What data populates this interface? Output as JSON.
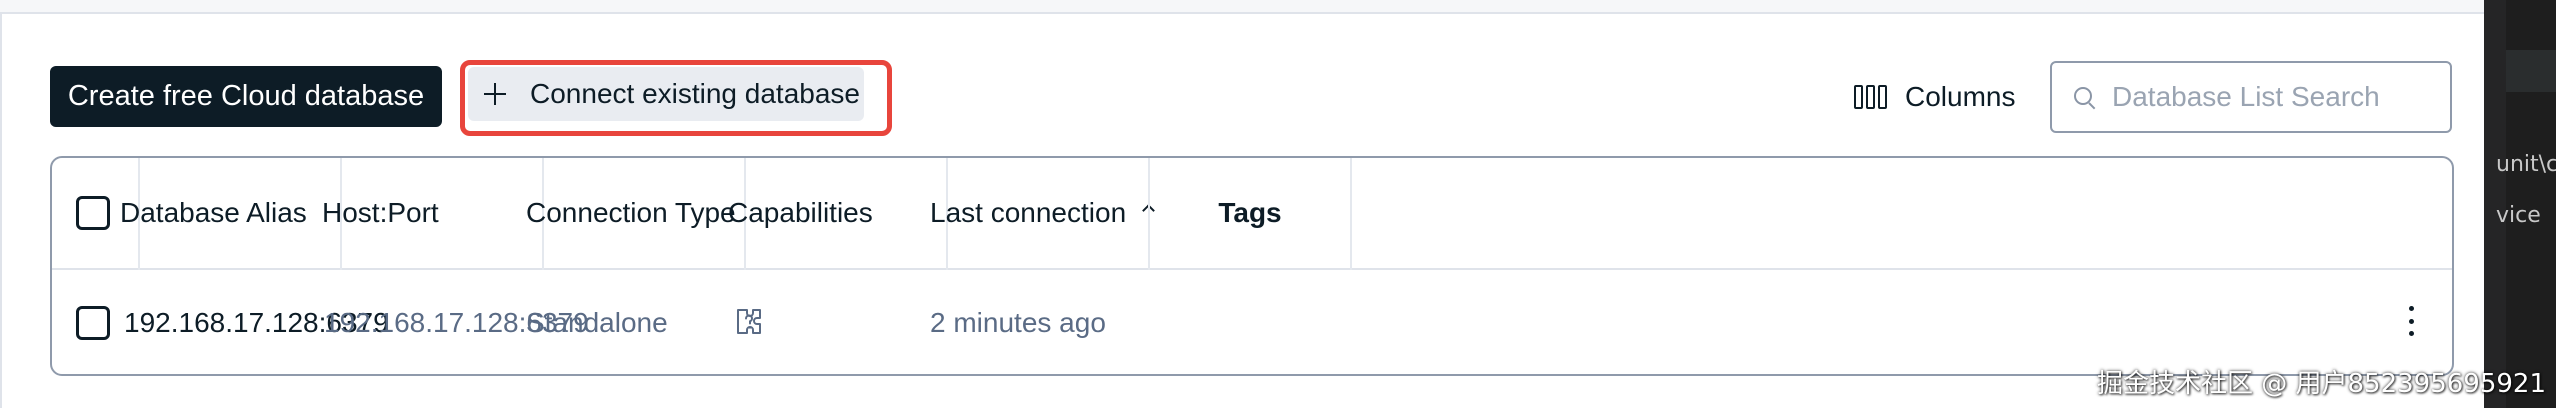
{
  "toolbar": {
    "create_label": "Create free Cloud database",
    "connect_label": "Connect existing database",
    "columns_label": "Columns",
    "search_placeholder": "Database List Search"
  },
  "table": {
    "headers": [
      "Database Alias",
      "Host:Port",
      "Connection Type",
      "Capabilities",
      "Last connection",
      "Tags"
    ],
    "sorted_column": "Last connection",
    "sort_direction": "ascending",
    "rows": [
      {
        "alias": "192.168.17.128:6379",
        "host_port": "192.168.17.128:6379",
        "connection_type": "Standalone",
        "capabilities_icon": "puzzle-question-icon",
        "last_connection": "2 minutes ago",
        "tags": ""
      }
    ]
  },
  "editor_strip": {
    "line1": "unit\\co",
    "line2": "vice"
  },
  "watermark": "掘金技术社区 @ 用户852395695921",
  "colors": {
    "primary_button_bg": "#0d1c26",
    "highlight_border": "#e8453c",
    "muted_text": "#5a6b85",
    "border": "#8f9aab"
  }
}
